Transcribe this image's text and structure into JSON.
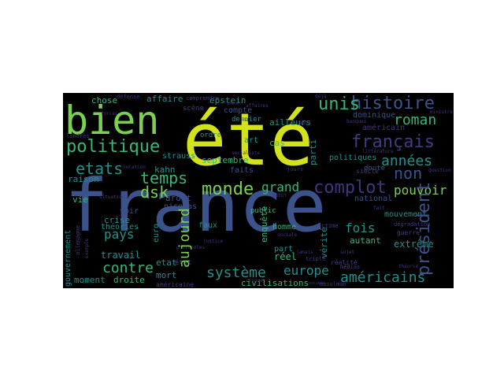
{
  "palette": {
    "yellow": "#d4e21a",
    "lime": "#7ad151",
    "green": "#35b779",
    "teal": "#21918c",
    "blue": "#2c728e",
    "slate": "#3b528b",
    "indigo": "#443a83",
    "purple": "#46327e",
    "dark": "#440154"
  },
  "words": {
    "france": "france",
    "ete": "été",
    "bien": "bien",
    "histoire": "histoire",
    "politique": "politique",
    "unis": "unis",
    "francais": "français",
    "etats": "etats",
    "temps": "temps",
    "roman": "roman",
    "annees": "années",
    "non": "non",
    "monde": "monde",
    "complot": "complot",
    "dsk": "dsk",
    "grand": "grand",
    "pouvoir": "pouvoir",
    "contre": "contre",
    "americains": "américains",
    "systeme": "système",
    "europe": "europe",
    "fois": "fois",
    "president": "président",
    "pays": "pays",
    "aujourd": "aujourd",
    "gouvernement": "gouvernement",
    "chose": "chose",
    "affaire": "affaire",
    "epstein": "epstein",
    "septembre": "septembre",
    "strauss": "strauss",
    "kahn": "kahn",
    "raison": "raison",
    "crise": "crise",
    "theories": "théories",
    "travail": "travail",
    "moment": "moment",
    "droite": "droite",
    "mort": "mort",
    "euro": "euro",
    "etat": "etat",
    "civilisations": "civilisations",
    "reel": "réel",
    "autant": "autant",
    "extreme": "extrême",
    "part": "part",
    "homme": "homme",
    "enquete": "enquête",
    "faits": "faits",
    "cas": "cas",
    "parti": "parti",
    "ailleurs": "ailleurs",
    "compte": "compte",
    "dernier": "dernier",
    "dominique": "dominique",
    "americain": "américain",
    "politiques": "politiques",
    "doute": "doute",
    "national": "national",
    "verite": "vérité",
    "droit": "droit",
    "nicolas": "nicolas",
    "faux": "faux",
    "voir": "voir",
    "vie": "vie",
    "mouvement": "mouvement",
    "public": "public",
    "art": "art",
    "ordre": "ordre",
    "scene": "scène",
    "comprendre": "comprendre",
    "etat2": "état",
    "americaine": "américaine",
    "guerre": "guerre",
    "siecle": "siècle",
    "realite": "réalité",
    "medias": "médias",
    "triple": "triple",
    "degradation": "dégradation",
    "victime": "victime",
    "musulman": "musulman",
    "londres": "londres",
    "defense": "défense",
    "jours": "jours",
    "banques": "banques",
    "note": "note",
    "mal": "mal",
    "sujet": "sujet",
    "forces": "forces",
    "situation": "situation",
    "justice": "justice",
    "exemple": "exemple",
    "allemagne": "allemagne",
    "litterature": "littérature",
    "question": "question",
    "debut": "début",
    "socialiste": "socialiste",
    "ministre": "ministre",
    "theorie": "théorie",
    "sociale": "sociale",
    "jamais": "jamais",
    "risque": "risque",
    "protocoles": "protocoles",
    "grece": "grèce",
    "affaires": "affaires",
    "societe": "société",
    "deja": "déjà",
    "notation": "notation",
    "fait": "fait"
  }
}
